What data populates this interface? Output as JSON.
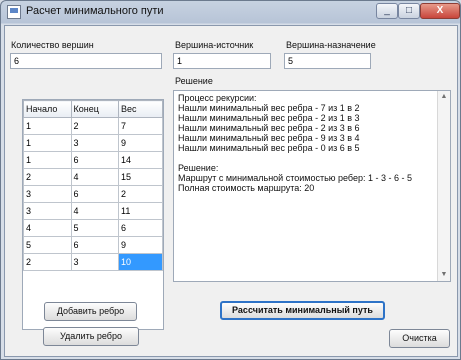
{
  "window": {
    "title": "Расчет минимального пути",
    "controls": [
      "_",
      "□",
      "X"
    ]
  },
  "fields": {
    "vertex_count_label": "Количество вершин",
    "vertex_count_value": "6",
    "source_label": "Вершина-источник",
    "source_value": "1",
    "target_label": "Вершина-назначение",
    "target_value": "5"
  },
  "grid": {
    "columns": [
      "Начало",
      "Конец",
      "Вес"
    ],
    "rows": [
      [
        "1",
        "2",
        "7"
      ],
      [
        "1",
        "3",
        "9"
      ],
      [
        "1",
        "6",
        "14"
      ],
      [
        "2",
        "4",
        "15"
      ],
      [
        "3",
        "6",
        "2"
      ],
      [
        "3",
        "4",
        "11"
      ],
      [
        "4",
        "5",
        "6"
      ],
      [
        "5",
        "6",
        "9"
      ],
      [
        "2",
        "3",
        "10"
      ]
    ],
    "selected_cell": "10"
  },
  "solution": {
    "label": "Решение",
    "text": "Процесс рекурсии:\nНашли минимальный вес ребра - 7 из 1 в 2\nНашли минимальный вес ребра - 2 из 1 в 3\nНашли минимальный вес ребра - 2 из 3 в 6\nНашли минимальный вес ребра - 9 из 3 в 4\nНашли минимальный вес ребра - 0 из 6 в 5\n\nРешение:\nМаршрут с минимальной стоимостью ребер: 1 - 3 - 6 - 5\nПолная стоимость маршрута: 20"
  },
  "buttons": {
    "add_edge": "Добавить ребро",
    "delete_edge": "Удалить ребро",
    "calculate": "Рассчитать минимальный путь",
    "clear": "Очистка"
  },
  "icons": {
    "app": "window-icon",
    "scroll_up": "▲",
    "scroll_down": "▼"
  },
  "colors": {
    "selection": "#3399ff",
    "primary_border": "#2e73c7"
  }
}
